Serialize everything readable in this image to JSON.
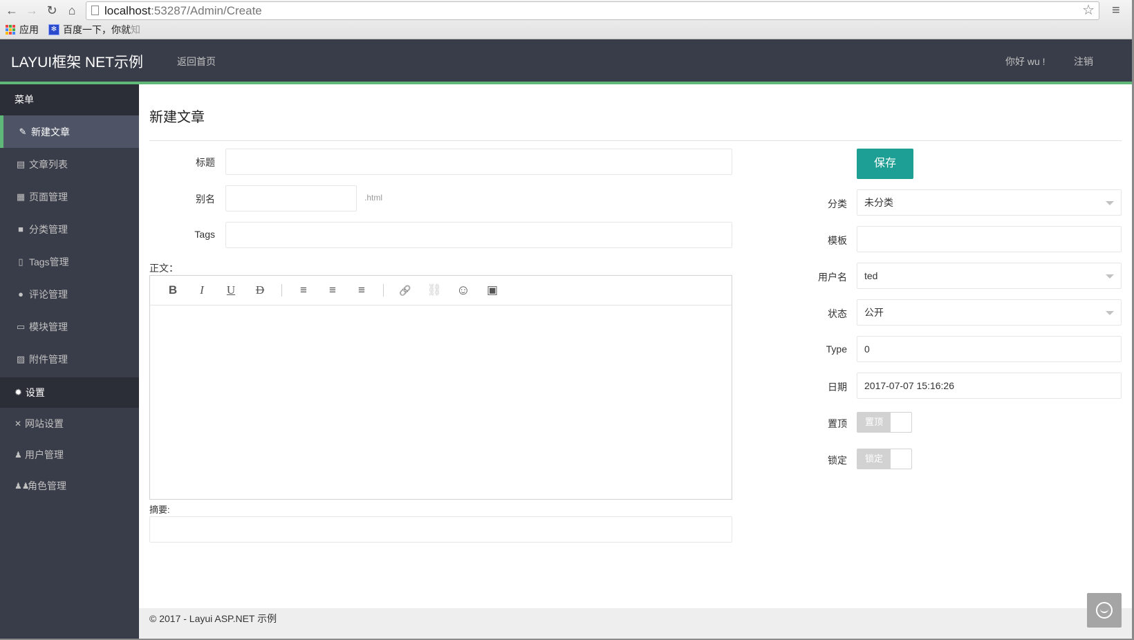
{
  "browser": {
    "url_host": "localhost",
    "url_rest": ":53287/Admin/Create",
    "bookmarks": [
      {
        "label": "应用",
        "icon": "apps-grid-icon"
      },
      {
        "label": "百度一下，你就",
        "label_faded": "知",
        "icon": "baidu-paw-icon"
      }
    ]
  },
  "header": {
    "brand": "LAYUI框架 NET示例",
    "home_link": "返回首页",
    "greeting": "你好 wu !",
    "logout": "注销",
    "accent_color": "#5FB878"
  },
  "sidebar": {
    "group_menu": "菜单",
    "items": [
      {
        "label": "新建文章",
        "icon": "pencil-icon",
        "active": true
      },
      {
        "label": "文章列表",
        "icon": "list-icon"
      },
      {
        "label": "页面管理",
        "icon": "calendar-page-icon"
      },
      {
        "label": "分类管理",
        "icon": "folder-icon"
      },
      {
        "label": "Tags管理",
        "icon": "file-icon"
      },
      {
        "label": "评论管理",
        "icon": "comment-icon"
      },
      {
        "label": "模块管理",
        "icon": "window-icon"
      },
      {
        "label": "附件管理",
        "icon": "image-icon"
      }
    ],
    "group_settings": "设置",
    "settings_items": [
      {
        "label": "网站设置",
        "icon": "tools-icon"
      },
      {
        "label": "用户管理",
        "icon": "user-icon"
      },
      {
        "label": "角色管理",
        "icon": "users-icon"
      }
    ]
  },
  "main": {
    "title": "新建文章",
    "fields": {
      "title_label": "标题",
      "title_value": "",
      "alias_label": "别名",
      "alias_value": "",
      "alias_suffix": ".html",
      "tags_label": "Tags",
      "tags_value": "",
      "body_label": "正文：",
      "summary_label": "摘要:",
      "summary_value": ""
    },
    "editor_toolbar": [
      {
        "name": "bold",
        "glyph": "B"
      },
      {
        "name": "italic",
        "glyph": "I"
      },
      {
        "name": "underline",
        "glyph": "U"
      },
      {
        "name": "strikethrough",
        "glyph": "D"
      },
      {
        "name": "align-left",
        "glyph": "≡"
      },
      {
        "name": "align-center",
        "glyph": "≡"
      },
      {
        "name": "align-right",
        "glyph": "≡"
      },
      {
        "name": "link",
        "glyph": "🔗"
      },
      {
        "name": "unlink",
        "glyph": "⛓"
      },
      {
        "name": "emoji",
        "glyph": "☺"
      },
      {
        "name": "image",
        "glyph": "▣"
      }
    ],
    "side": {
      "save_label": "保存",
      "save_color": "#1E9F95",
      "category_label": "分类",
      "category_value": "未分类",
      "template_label": "模板",
      "template_value": "",
      "username_label": "用户名",
      "username_value": "ted",
      "status_label": "状态",
      "status_value": "公开",
      "type_label": "Type",
      "type_value": "0",
      "date_label": "日期",
      "date_value": "2017-07-07 15:16:26",
      "top_label": "置顶",
      "top_switch_text": "置顶",
      "top_checked": false,
      "lock_label": "锁定",
      "lock_switch_text": "锁定",
      "lock_checked": false
    }
  },
  "footer": {
    "text": "© 2017 - Layui ASP.NET 示例"
  }
}
